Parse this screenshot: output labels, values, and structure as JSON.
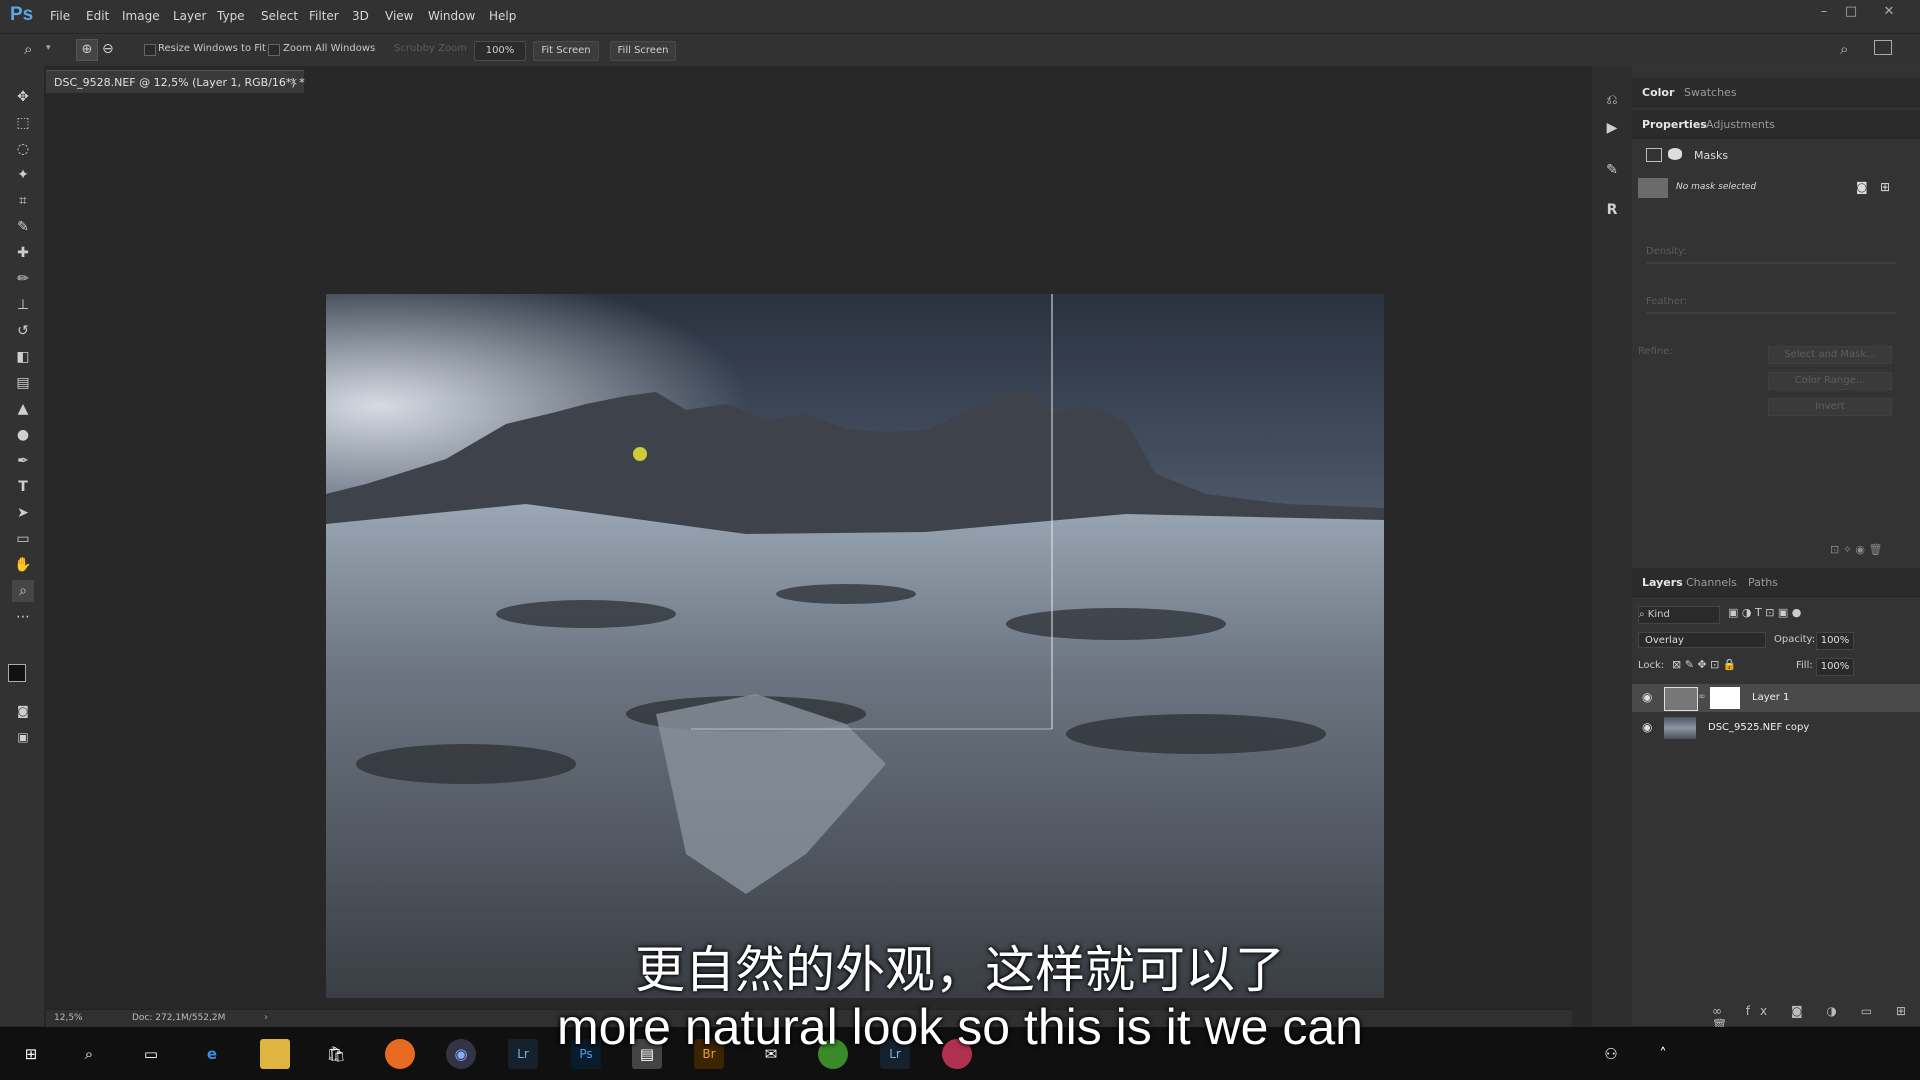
{
  "app": {
    "logo": "Ps"
  },
  "menu": [
    "File",
    "Edit",
    "Image",
    "Layer",
    "Type",
    "Select",
    "Filter",
    "3D",
    "View",
    "Window",
    "Help"
  ],
  "options": {
    "resize_windows": "Resize Windows to Fit",
    "zoom_all": "Zoom All Windows",
    "scrubby_zoom": "Scrubby Zoom",
    "zoom_value": "100%",
    "fit_screen": "Fit Screen",
    "fill_screen": "Fill Screen"
  },
  "document": {
    "tab_title": "DSC_9528.NEF @ 12,5% (Layer 1, RGB/16*) *",
    "close": "×"
  },
  "status": {
    "zoom": "12,5%",
    "doc": "Doc: 272,1M/552,2M"
  },
  "panels": {
    "top_tabs": [
      "Color",
      "Swatches"
    ],
    "props_tabs": [
      "Properties",
      "Adjustments"
    ],
    "masks_label": "Masks",
    "no_mask": "No mask selected",
    "density": "Density:",
    "feather": "Feather:",
    "refine": "Refine:",
    "select_mask": "Select and Mask...",
    "color_range": "Color Range...",
    "invert": "Invert"
  },
  "layers": {
    "tabs": [
      "Layers",
      "Channels",
      "Paths"
    ],
    "kind": "Kind",
    "blend_mode": "Overlay",
    "opacity_label": "Opacity:",
    "opacity": "100%",
    "lock_label": "Lock:",
    "fill_label": "Fill:",
    "fill": "100%",
    "items": [
      {
        "name": "Layer 1"
      },
      {
        "name": "DSC_9525.NEF copy"
      }
    ]
  },
  "subtitles": {
    "chinese": "更自然的外观，这样就可以了",
    "english": "more natural look so this is it we can"
  },
  "colors": {
    "accent": "#5aa7e6",
    "foreground": "#111111",
    "background": "#3fb0d8"
  }
}
